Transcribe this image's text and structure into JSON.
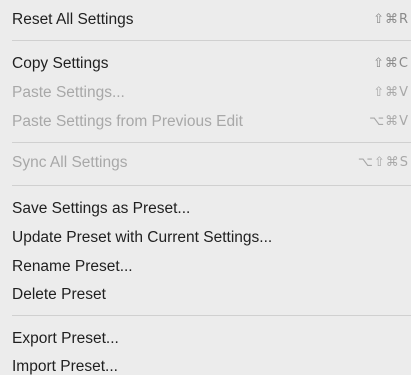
{
  "menu": {
    "items": [
      {
        "label": "Reset All Settings",
        "shortcut": "⇧⌘R",
        "enabled": true
      },
      {
        "label": "Copy Settings",
        "shortcut": "⇧⌘C",
        "enabled": true
      },
      {
        "label": "Paste Settings...",
        "shortcut": "⇧⌘V",
        "enabled": false
      },
      {
        "label": "Paste Settings from Previous Edit",
        "shortcut": "⌥⌘V",
        "enabled": false
      },
      {
        "label": "Sync All Settings",
        "shortcut": "⌥⇧⌘S",
        "enabled": false
      },
      {
        "label": "Save Settings as Preset...",
        "shortcut": "",
        "enabled": true
      },
      {
        "label": "Update Preset with Current Settings...",
        "shortcut": "",
        "enabled": true
      },
      {
        "label": "Rename Preset...",
        "shortcut": "",
        "enabled": true
      },
      {
        "label": "Delete Preset",
        "shortcut": "",
        "enabled": true
      },
      {
        "label": "Export Preset...",
        "shortcut": "",
        "enabled": true
      },
      {
        "label": "Import Preset...",
        "shortcut": "",
        "enabled": true
      }
    ]
  },
  "colors": {
    "background": "#ececec",
    "text": "#1f1f1f",
    "disabled_text": "#a8a8a8",
    "shortcut_text": "#8a8a8a",
    "separator": "#d0d0d0"
  }
}
